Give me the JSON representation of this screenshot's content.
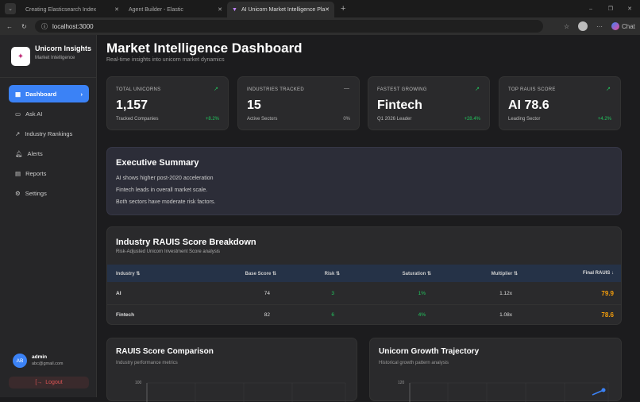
{
  "browser": {
    "tabs": [
      {
        "title": "Creating Elasticsearch Index"
      },
      {
        "title": "Agent Builder - Elastic"
      },
      {
        "title": "AI Unicorn Market Intelligence Pla"
      }
    ],
    "url": "localhost:3000",
    "chat_label": "Chat"
  },
  "sidebar": {
    "brand": "Unicorn Insights",
    "tagline": "Market Intelligence",
    "items": [
      {
        "label": "Dashboard",
        "icon": "grid-icon"
      },
      {
        "label": "Ask AI",
        "icon": "chat-icon"
      },
      {
        "label": "Industry Rankings",
        "icon": "trend-icon"
      },
      {
        "label": "Alerts",
        "icon": "bell-icon"
      },
      {
        "label": "Reports",
        "icon": "file-icon"
      },
      {
        "label": "Settings",
        "icon": "gear-icon"
      }
    ],
    "user": {
      "initials": "AB",
      "name": "admin",
      "email": "abc@gmail.com"
    },
    "logout": "Logout"
  },
  "header": {
    "title": "Market Intelligence Dashboard",
    "subtitle": "Real-time insights into unicorn market dynamics"
  },
  "stats": [
    {
      "label": "TOTAL UNICORNS",
      "value": "1,157",
      "sub": "Tracked Companies",
      "change": "+8.2%",
      "icon": "↗"
    },
    {
      "label": "INDUSTRIES TRACKED",
      "value": "15",
      "sub": "Active Sectors",
      "change": "0%",
      "icon": "—"
    },
    {
      "label": "FASTEST GROWING",
      "value": "Fintech",
      "sub": "Q1 2026 Leader",
      "change": "+28.4%",
      "icon": "↗"
    },
    {
      "label": "TOP RAUIS SCORE",
      "value": "AI 78.6",
      "sub": "Leading Sector",
      "change": "+4.2%",
      "icon": "↗"
    }
  ],
  "summary": {
    "title": "Executive Summary",
    "lines": [
      "AI shows higher post-2020 acceleration",
      "Fintech leads in overall market scale.",
      "Both sectors have moderate risk factors."
    ]
  },
  "table": {
    "title": "Industry RAUIS Score Breakdown",
    "subtitle": "Risk-Adjusted Unicorn Investment Score analysis",
    "columns": [
      "Industry ⇅",
      "Base Score ⇅",
      "Risk ⇅",
      "Saturation ⇅",
      "Multiplier ⇅",
      "Final RAUIS ↓"
    ],
    "rows": [
      [
        "AI",
        "74",
        "3",
        "1%",
        "1.12x",
        "79.9"
      ],
      [
        "Fintech",
        "82",
        "6",
        "4%",
        "1.08x",
        "78.6"
      ]
    ]
  },
  "charts": [
    {
      "title": "RAUIS Score Comparison",
      "subtitle": "Industry performance metrics",
      "ytick": "100"
    },
    {
      "title": "Unicorn Growth Trajectory",
      "subtitle": "Historical growth pattern analysis",
      "ytick": "120"
    }
  ]
}
